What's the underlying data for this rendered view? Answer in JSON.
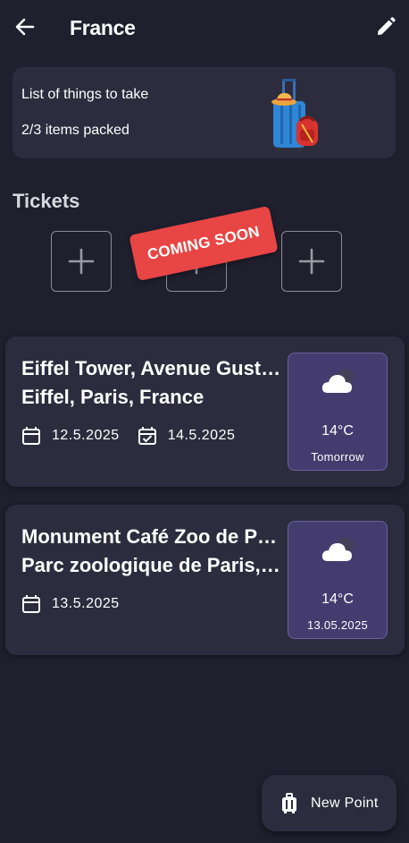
{
  "appbar": {
    "title": "France",
    "back_icon": "arrow-left-icon",
    "edit_icon": "pencil-icon"
  },
  "packing": {
    "title": "List of things to take",
    "count": "2/3 items packed",
    "illustration": "luggage-illustration"
  },
  "tickets": {
    "label": "Tickets",
    "slot_icon": "plus-icon",
    "badge": "COMING SOON",
    "badge_color": "#e84545"
  },
  "points": [
    {
      "name_lines": [
        "Eiffel Tower, Avenue Gustave",
        "Eiffel, Paris, France"
      ],
      "start_date": "12.5.2025",
      "end_date": "14.5.2025",
      "weather": {
        "icon": "cloudy-night-icon",
        "temp": "14°C",
        "day": "Tomorrow"
      }
    },
    {
      "name_lines": [
        "Monument Café Zoo de Paris,",
        "Parc zoologique de Paris, Ave…"
      ],
      "start_date": "13.5.2025",
      "weather": {
        "icon": "cloudy-night-icon",
        "temp": "14°C",
        "day": "13.05.2025"
      }
    }
  ],
  "fab": {
    "label": "New Point",
    "icon": "suitcase-icon"
  },
  "colors": {
    "background": "#1f1f2e",
    "card": "#2d2c3e",
    "weather_box": "#443c6e"
  }
}
